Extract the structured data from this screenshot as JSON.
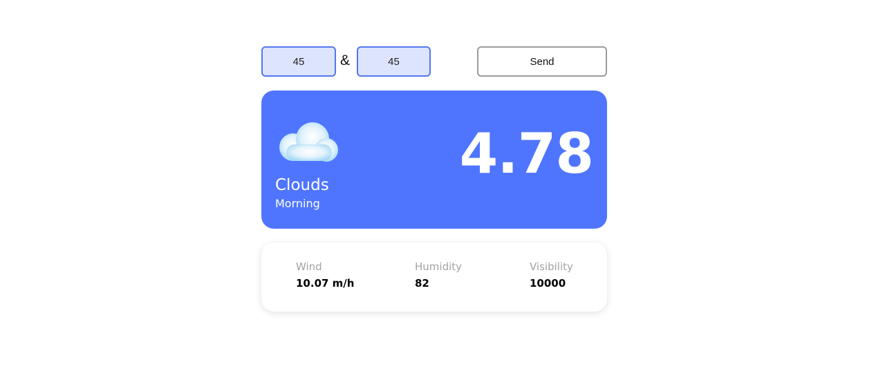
{
  "controls": {
    "latitude_value": "45",
    "separator": "&",
    "longitude_value": "45",
    "send_label": "Send"
  },
  "weather": {
    "icon": "cloud-icon",
    "condition": "Clouds",
    "period": "Morning",
    "temperature": "4.78",
    "card_color": "#4f75ff"
  },
  "details": {
    "wind": {
      "label": "Wind",
      "value": "10.07 m/h"
    },
    "humidity": {
      "label": "Humidity",
      "value": "82"
    },
    "visibility": {
      "label": "Visibility",
      "value": "10000"
    }
  }
}
